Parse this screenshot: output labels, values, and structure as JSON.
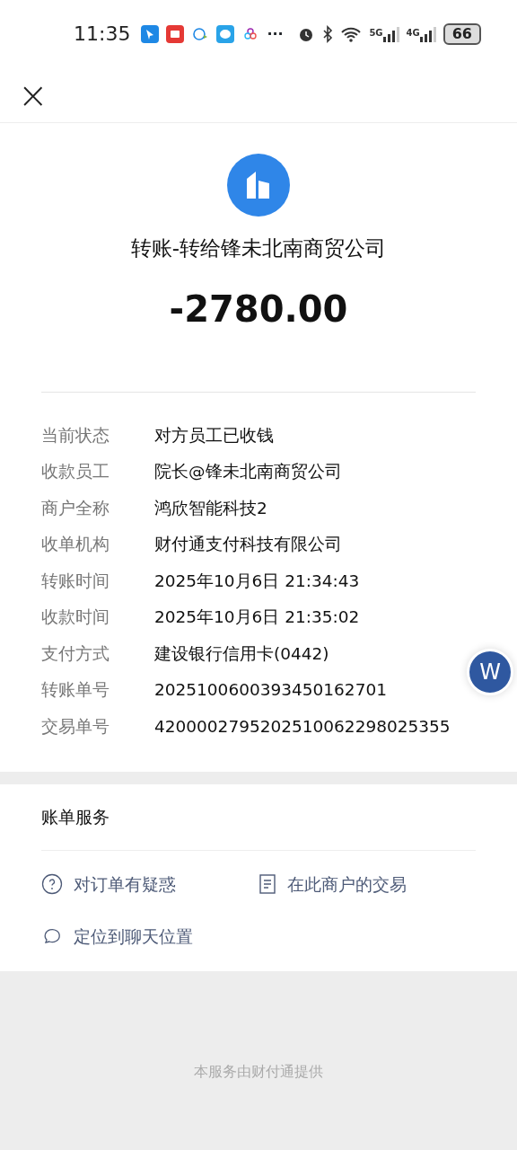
{
  "status_bar": {
    "time": "11:35",
    "notifications": [
      {
        "kind": "app"
      },
      {
        "kind": "mail"
      },
      {
        "kind": "chat"
      },
      {
        "kind": "message"
      },
      {
        "kind": "cluster"
      }
    ],
    "more": "···",
    "network_5g": "5G",
    "network_4g": "4G",
    "battery": "66"
  },
  "header": {
    "close": "×"
  },
  "merchant": {
    "title": "转账-转给锋未北南商贸公司"
  },
  "amount": "-2780.00",
  "details": [
    {
      "label": "当前状态",
      "value": "对方员工已收钱"
    },
    {
      "label": "收款员工",
      "value": "院长@锋未北南商贸公司"
    },
    {
      "label": "商户全称",
      "value": "鸿欣智能科技2"
    },
    {
      "label": "收单机构",
      "value": "财付通支付科技有限公司"
    },
    {
      "label": "转账时间",
      "value": "2025年10月6日 21:34:43"
    },
    {
      "label": "收款时间",
      "value": "2025年10月6日 21:35:02"
    },
    {
      "label": "支付方式",
      "value": "建设银行信用卡(0442)"
    },
    {
      "label": "转账单号",
      "value": "2025100600393450162701"
    },
    {
      "label": "交易单号",
      "value": "4200002795202510062298025355"
    }
  ],
  "services": {
    "title": "账单服务",
    "actions": [
      {
        "label": "对订单有疑惑",
        "kind": "question"
      },
      {
        "label": "在此商户的交易",
        "kind": "document"
      },
      {
        "label": "定位到聊天位置",
        "kind": "chat"
      }
    ]
  },
  "floating_button": {
    "label": "W"
  },
  "footer": "本服务由财付通提供"
}
